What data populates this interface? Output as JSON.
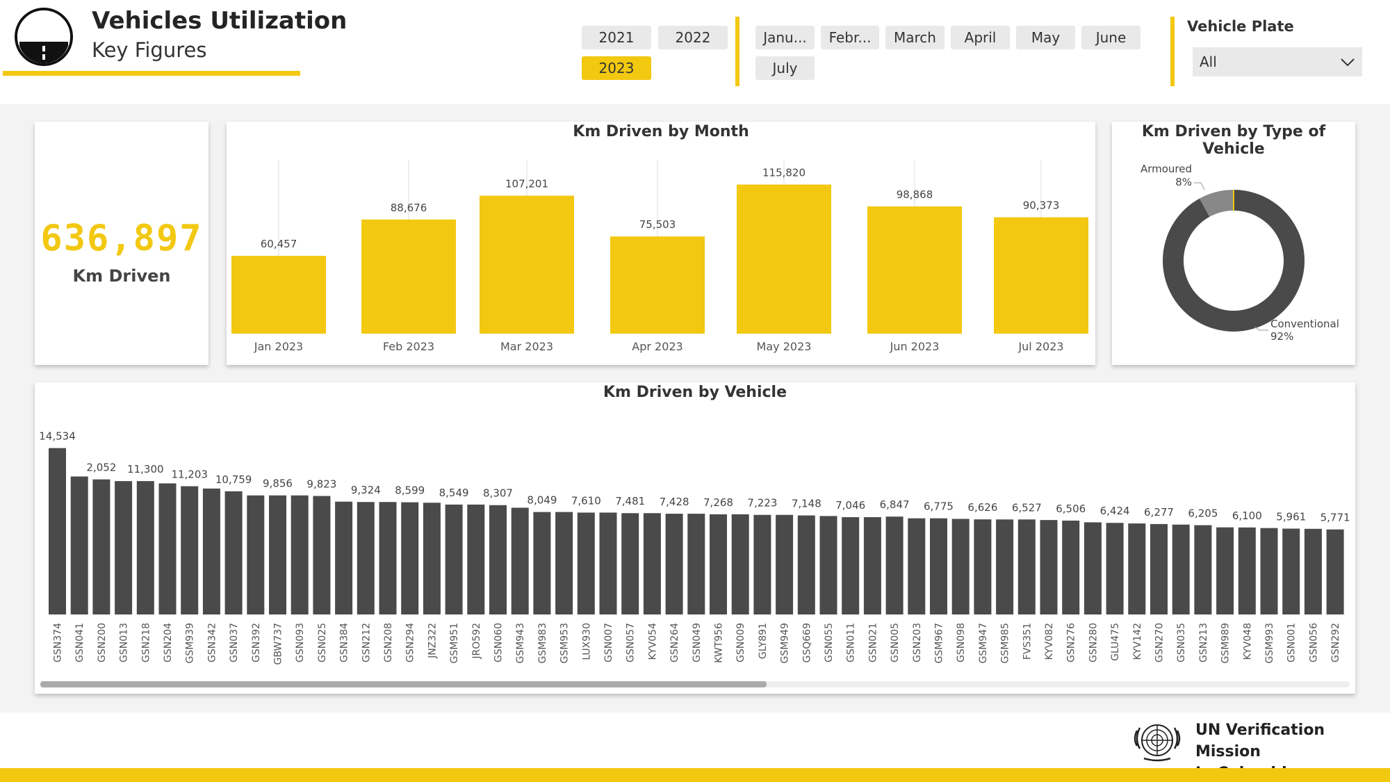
{
  "header": {
    "title": "Vehicles Utilization",
    "subtitle": "Key Figures",
    "accent_color": "#F2C811"
  },
  "year_slicer": {
    "options": [
      "2021",
      "2022",
      "2023"
    ],
    "selected": "2023"
  },
  "month_slicer": {
    "options": [
      "Janu...",
      "Febr...",
      "March",
      "April",
      "May",
      "June",
      "July"
    ]
  },
  "vehicle_plate": {
    "label": "Vehicle Plate",
    "value": "All"
  },
  "kpi": {
    "value": "636,897",
    "label": "Km Driven"
  },
  "chart_data": [
    {
      "type": "bar",
      "title": "Km Driven by Month",
      "categories": [
        "Jan 2023",
        "Feb 2023",
        "Mar 2023",
        "Apr 2023",
        "May 2023",
        "Jun 2023",
        "Jul 2023"
      ],
      "values": [
        60457,
        88676,
        107201,
        75503,
        115820,
        98868,
        90373
      ],
      "value_labels": [
        "60,457",
        "88,676",
        "107,201",
        "75,503",
        "115,820",
        "98,868",
        "90,373"
      ],
      "color": "#F2C811",
      "ylim": [
        0,
        135000
      ],
      "grid": false
    },
    {
      "type": "pie",
      "title": "Km Driven by Type of Vehicle",
      "labels": [
        "Armoured",
        "Conventional"
      ],
      "values": [
        8,
        92
      ],
      "pct_labels": [
        "8%",
        "92%"
      ],
      "colors": [
        "#888888",
        "#4a4a4a"
      ]
    },
    {
      "type": "bar",
      "title": "Km Driven by Vehicle",
      "categories": [
        "GSN374",
        "GSN041",
        "GSN200",
        "GSN013",
        "GSN218",
        "GSN204",
        "GSM939",
        "GSN342",
        "GSN037",
        "GSN392",
        "GBW737",
        "GSN093",
        "GSN025",
        "GSN384",
        "GSN212",
        "GSN208",
        "GSN294",
        "JNZ322",
        "GSM951",
        "JRO592",
        "GSN060",
        "GSM943",
        "GSM983",
        "GSM953",
        "LUX930",
        "GSN007",
        "GSN057",
        "KYV054",
        "GSN264",
        "GSN049",
        "KWT956",
        "GSN009",
        "GLY891",
        "GSM949",
        "GSQ669",
        "GSN055",
        "GSN011",
        "GSN021",
        "GSN005",
        "GSN203",
        "GSM967",
        "GSN098",
        "GSM947",
        "GSM985",
        "FVS351",
        "KYV082",
        "GSN276",
        "GSN280",
        "GLU475",
        "KYV142",
        "GSN270",
        "GSN035",
        "GSN213",
        "GSM989",
        "KYV048",
        "GSM993",
        "GSN001",
        "GSN056",
        "GSN292"
      ],
      "values": [
        14534,
        12052,
        11800,
        11650,
        11650,
        11450,
        11203,
        11000,
        10759,
        10400,
        10400,
        10400,
        10350,
        9856,
        9823,
        9823,
        9800,
        9760,
        9600,
        9600,
        9550,
        9324,
        8950,
        8950,
        8900,
        8900,
        8850,
        8850,
        8800,
        8800,
        8750,
        8750,
        8700,
        8700,
        8650,
        8599,
        8500,
        8500,
        8549,
        8400,
        8400,
        8350,
        8307,
        8300,
        8300,
        8250,
        8200,
        8049,
        8000,
        7950,
        7900,
        7850,
        7800,
        7610,
        7600,
        7550,
        7500,
        7481,
        7428
      ],
      "value_labels": [
        "14,534",
        "2,052",
        "11,300",
        "11,203",
        "10,759",
        "9,856",
        "9,823",
        "9,324",
        "8,599",
        "8,549",
        "8,307",
        "8,049",
        "7,610",
        "7,481",
        "7,428",
        "7,268",
        "7,223",
        "7,148",
        "7,046",
        "6,847",
        "6,775",
        "6,626",
        "6,527",
        "6,506",
        "6,424",
        "6,277",
        "6,205",
        "6,100",
        "5,961",
        "5,771"
      ],
      "color": "#4a4a4a",
      "ylim": [
        0,
        16000
      ],
      "grid": false
    }
  ],
  "footer": {
    "org_line1": "UN Verification Mission",
    "org_line2": "In Colombia"
  }
}
